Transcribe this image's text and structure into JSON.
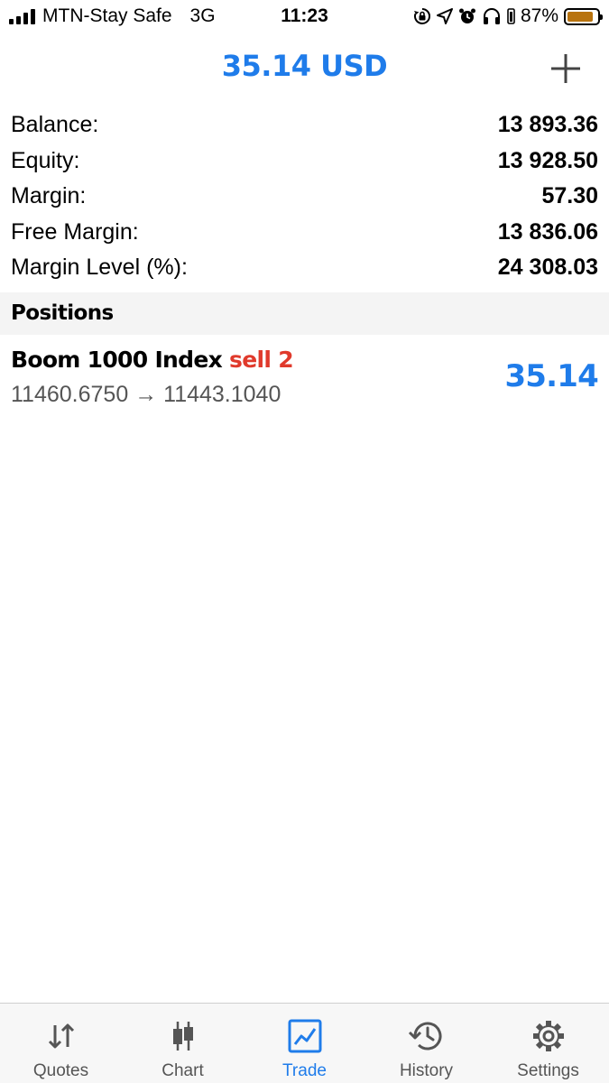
{
  "status_bar": {
    "carrier": "MTN-Stay Safe",
    "network": "3G",
    "time": "11:23",
    "battery_percent": "87%",
    "battery_level": 0.87,
    "battery_color": "#b8730f"
  },
  "header": {
    "title": "35.14 USD",
    "add_icon": "plus-icon"
  },
  "summary": {
    "rows": [
      {
        "label": "Balance:",
        "value": "13 893.36"
      },
      {
        "label": "Equity:",
        "value": "13 928.50"
      },
      {
        "label": "Margin:",
        "value": "57.30"
      },
      {
        "label": "Free Margin:",
        "value": "13 836.06"
      },
      {
        "label": "Margin Level (%):",
        "value": "24 308.03"
      }
    ]
  },
  "positions": {
    "header": "Positions",
    "items": [
      {
        "symbol": "Boom 1000 Index",
        "side": "sell 2",
        "open_price": "11460.6750",
        "arrow": "→",
        "current_price": "11443.1040",
        "profit": "35.14"
      }
    ]
  },
  "tabs": [
    {
      "label": "Quotes",
      "icon": "quotes-arrows-icon",
      "active": false
    },
    {
      "label": "Chart",
      "icon": "candlestick-chart-icon",
      "active": false
    },
    {
      "label": "Trade",
      "icon": "trade-chart-icon",
      "active": true
    },
    {
      "label": "History",
      "icon": "history-clock-icon",
      "active": false
    },
    {
      "label": "Settings",
      "icon": "gear-icon",
      "active": false
    }
  ],
  "colors": {
    "accent": "#1f7cea",
    "sell": "#e03a2c",
    "section_bg": "#f4f4f4",
    "tab_bar_bg": "#f7f7f7"
  }
}
